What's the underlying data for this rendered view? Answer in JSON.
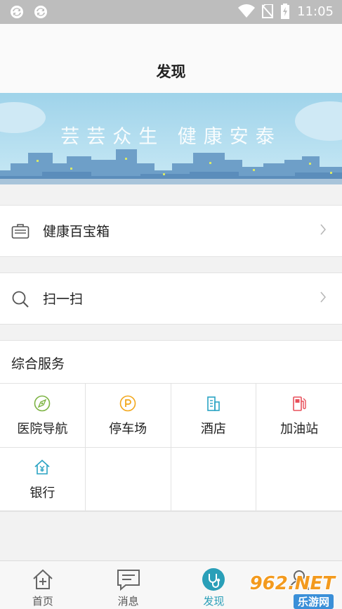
{
  "status_bar": {
    "time": "11:05",
    "icons": [
      "sync-icon",
      "sync-icon",
      "wifi-icon",
      "no-sim-icon",
      "battery-charging-icon"
    ]
  },
  "header": {
    "title": "发现"
  },
  "banner": {
    "text": "芸芸众生 健康安泰"
  },
  "rows": [
    {
      "label": "健康百宝箱",
      "icon": "toolbox-icon"
    },
    {
      "label": "扫一扫",
      "icon": "search-icon"
    }
  ],
  "services": {
    "title": "综合服务",
    "items": [
      {
        "label": "医院导航",
        "icon": "compass-icon",
        "color": "#7cb342"
      },
      {
        "label": "停车场",
        "icon": "parking-icon",
        "color": "#f2a71b"
      },
      {
        "label": "酒店",
        "icon": "hotel-icon",
        "color": "#2aa3c3"
      },
      {
        "label": "加油站",
        "icon": "gas-station-icon",
        "color": "#e8505b"
      },
      {
        "label": "银行",
        "icon": "bank-icon",
        "color": "#2aa3c3"
      }
    ]
  },
  "tabbar": {
    "tabs": [
      {
        "label": "首页",
        "icon": "home-icon",
        "active": false
      },
      {
        "label": "消息",
        "icon": "message-icon",
        "active": false
      },
      {
        "label": "发现",
        "icon": "stethoscope-icon",
        "active": true
      },
      {
        "label": "",
        "icon": "profile-icon",
        "active": false
      }
    ],
    "active_color": "#2a9fb8"
  },
  "watermark": {
    "text": "962.NET",
    "subtext": "乐游网"
  }
}
